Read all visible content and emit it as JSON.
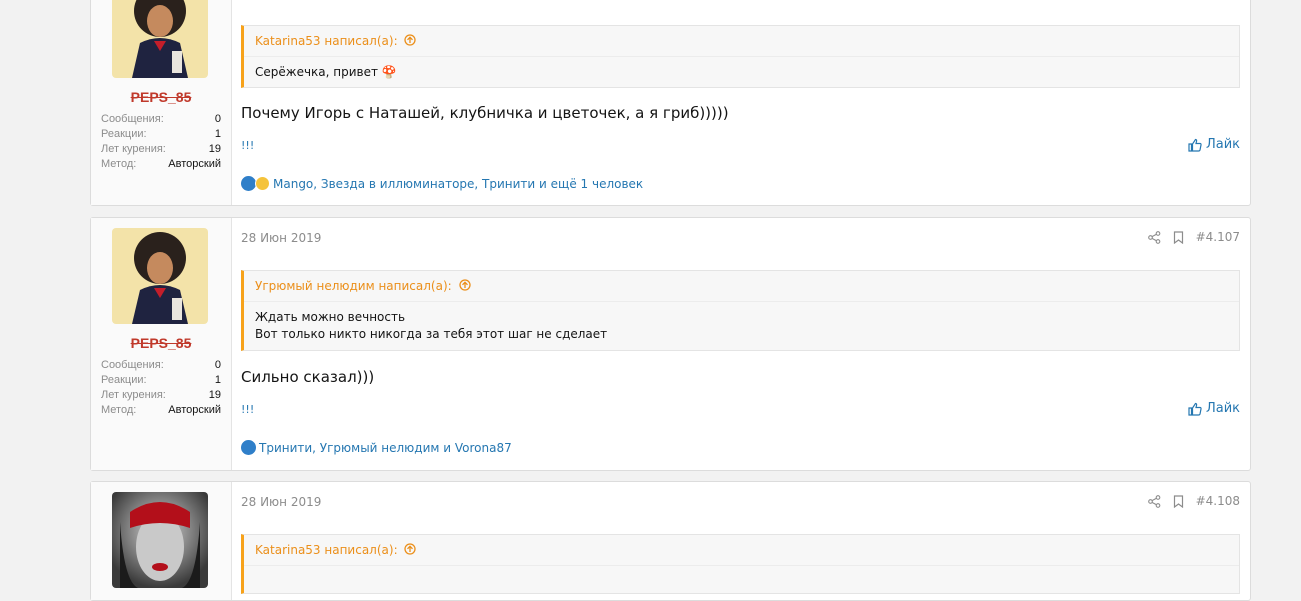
{
  "stat_labels": {
    "messages": "Сообщения:",
    "reactions": "Реакции:",
    "years": "Лет курения:",
    "method": "Метод:"
  },
  "like_label": "Лайк",
  "signature": "!!!",
  "posts": [
    {
      "username": "PEPS_85",
      "stats": {
        "messages": "0",
        "reactions": "1",
        "years": "19",
        "method": "Авторский"
      },
      "quote": {
        "author": "Katarina53 написал(а):",
        "lines": [
          "Серёжечка, привет 🍄"
        ]
      },
      "message": "Почему Игорь с Наташей, клубничка и цветочек, а я гриб)))))",
      "reactions_text": "Mango, Звезда в иллюминаторе, Тринити и ещё 1 человек"
    },
    {
      "username": "PEPS_85",
      "date": "28 Июн 2019",
      "number": "#4.107",
      "stats": {
        "messages": "0",
        "reactions": "1",
        "years": "19",
        "method": "Авторский"
      },
      "quote": {
        "author": "Угрюмый нелюдим написал(а):",
        "lines": [
          "Ждать можно вечность",
          "Вот только никто никогда за тебя этот шаг не сделает"
        ]
      },
      "message": "Сильно сказал)))",
      "reactions_text": "Тринити, Угрюмый нелюдим и Vorona87"
    },
    {
      "date": "28 Июн 2019",
      "number": "#4.108",
      "quote": {
        "author": "Katarina53 написал(а):"
      }
    }
  ],
  "colors": {
    "accent": "#2577b1",
    "quote_border": "#f7a21a",
    "username": "#c0392b"
  }
}
